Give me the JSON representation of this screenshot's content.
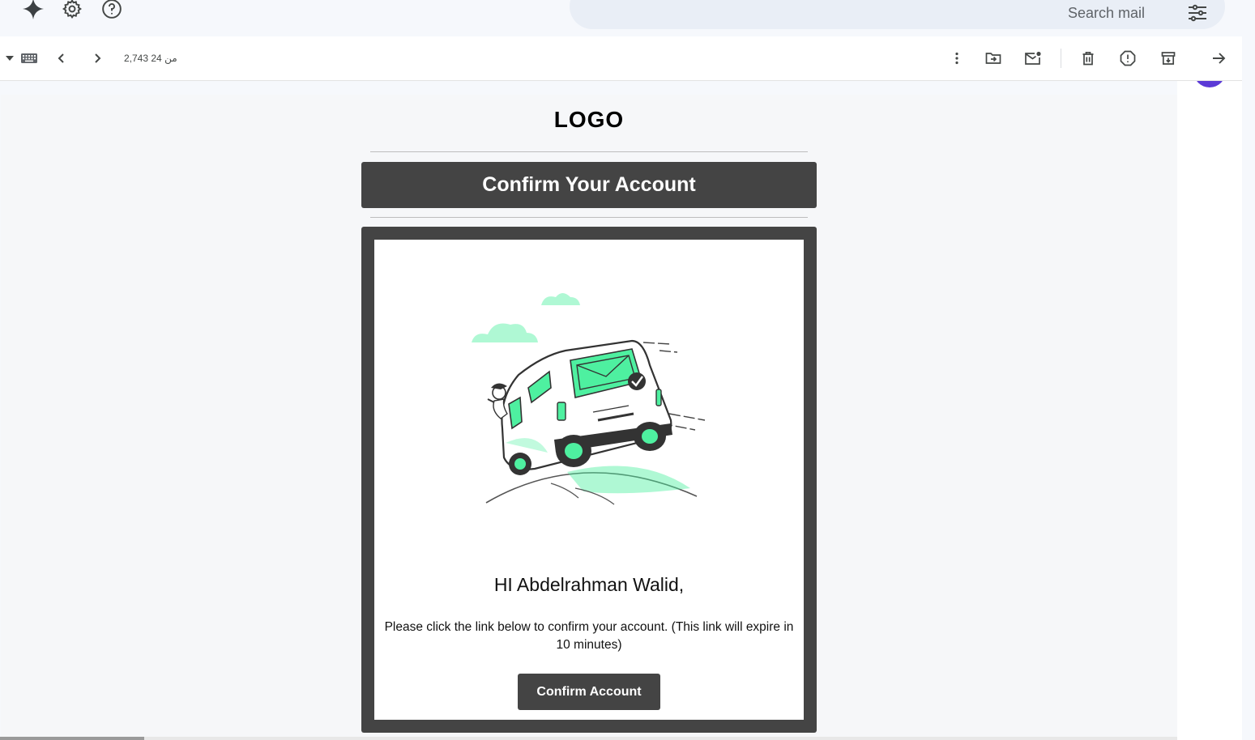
{
  "topbar": {
    "icons": [
      "gemini-sparkle-icon",
      "settings-gear-icon",
      "help-icon"
    ]
  },
  "search": {
    "placeholder": "Search mail",
    "options_icon": "search-options-icon"
  },
  "toolbar": {
    "pagination": "2,743 من 24",
    "icons": [
      "input-tools-caret-icon",
      "keyboard-icon",
      "chevron-left-icon",
      "chevron-right-icon",
      "more-vert-icon",
      "move-to-folder-icon",
      "mark-unread-icon",
      "delete-icon",
      "report-spam-icon",
      "archive-icon",
      "arrow-forward-icon"
    ]
  },
  "email": {
    "logo": "LOGO",
    "heading": "Confirm Your Account",
    "greeting": "HI Abdelrahman Walid,",
    "body": "Please click the link below to confirm your account. (This link will expire in 10 minutes)",
    "button_label": "Confirm Account",
    "illustration": "delivery-van-with-envelope-illustration"
  },
  "colors": {
    "email_dark": "#444444",
    "accent_green": "#4ef0a0",
    "avatar": "#5b3ad6",
    "search_bg": "#e9eef6"
  }
}
